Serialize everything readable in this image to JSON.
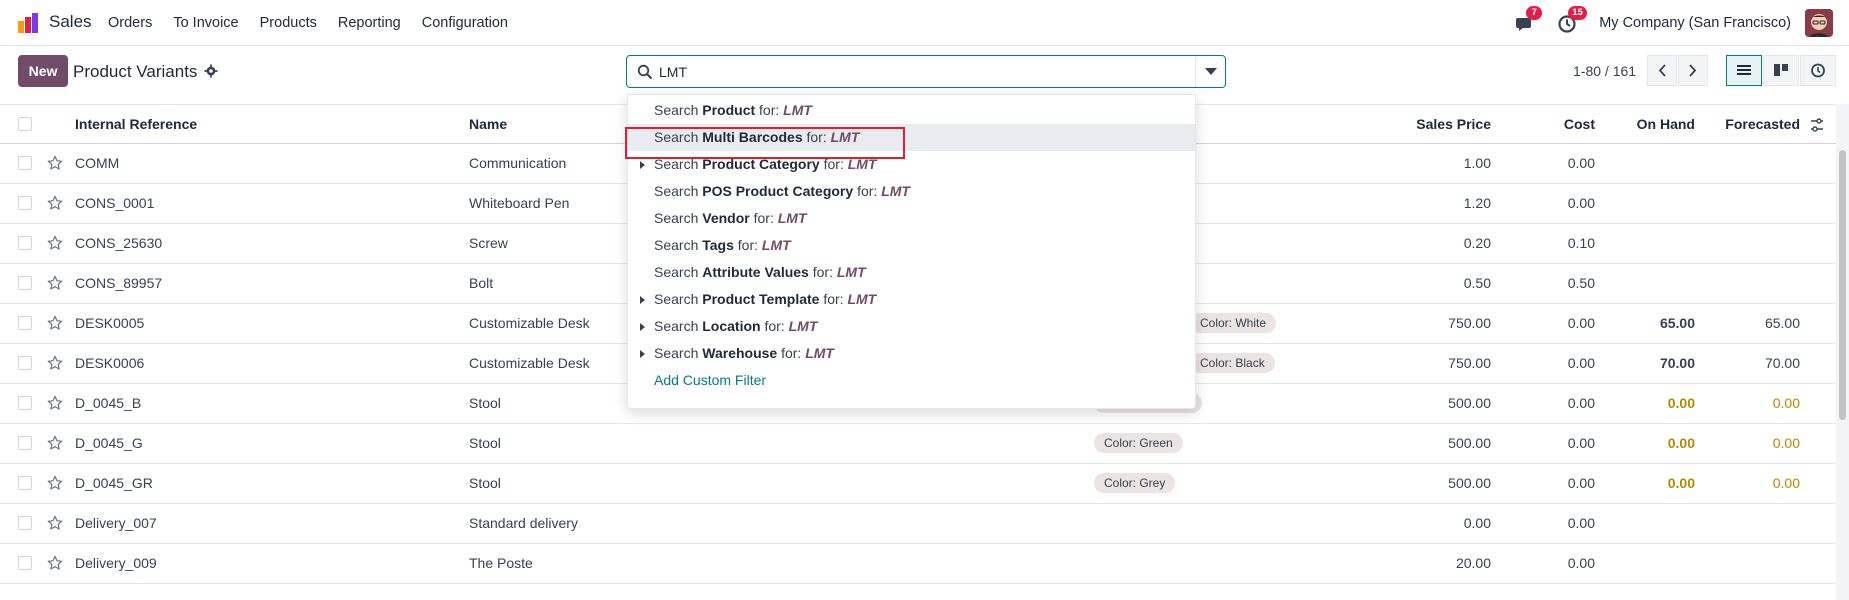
{
  "navbar": {
    "app_name": "Sales",
    "menu": [
      "Orders",
      "To Invoice",
      "Products",
      "Reporting",
      "Configuration"
    ],
    "messages_badge": "7",
    "activities_badge": "15",
    "company": "My Company (San Francisco)"
  },
  "control": {
    "new_label": "New",
    "title": "Product Variants",
    "search_value": "LMT",
    "pager": "1-80 / 161"
  },
  "columns": {
    "internal_reference": "Internal Reference",
    "name": "Name",
    "sales_price": "Sales Price",
    "cost": "Cost",
    "on_hand": "On Hand",
    "forecasted": "Forecasted"
  },
  "rows": [
    {
      "ref": "COMM",
      "name": "Communication",
      "tag": "",
      "price": "1.00",
      "cost": "0.00",
      "onhand": "",
      "forecast": ""
    },
    {
      "ref": "CONS_0001",
      "name": "Whiteboard Pen",
      "tag": "",
      "price": "1.20",
      "cost": "0.00",
      "onhand": "",
      "forecast": ""
    },
    {
      "ref": "CONS_25630",
      "name": "Screw",
      "tag": "",
      "price": "0.20",
      "cost": "0.10",
      "onhand": "",
      "forecast": ""
    },
    {
      "ref": "CONS_89957",
      "name": "Bolt",
      "tag": "",
      "price": "0.50",
      "cost": "0.50",
      "onhand": "",
      "forecast": ""
    },
    {
      "ref": "DESK0005",
      "name": "Customizable Desk",
      "tag": "Color: White",
      "price": "750.00",
      "cost": "0.00",
      "onhand": "65.00",
      "forecast": "65.00"
    },
    {
      "ref": "DESK0006",
      "name": "Customizable Desk",
      "tag": "Color: Black",
      "price": "750.00",
      "cost": "0.00",
      "onhand": "70.00",
      "forecast": "70.00"
    },
    {
      "ref": "D_0045_B",
      "name": "Stool",
      "tag": "",
      "price": "500.00",
      "cost": "0.00",
      "onhand": "0.00",
      "forecast": "0.00"
    },
    {
      "ref": "D_0045_G",
      "name": "Stool",
      "tag": "Color: Green",
      "price": "500.00",
      "cost": "0.00",
      "onhand": "0.00",
      "forecast": "0.00"
    },
    {
      "ref": "D_0045_GR",
      "name": "Stool",
      "tag": "Color: Grey",
      "price": "500.00",
      "cost": "0.00",
      "onhand": "0.00",
      "forecast": "0.00"
    },
    {
      "ref": "Delivery_007",
      "name": "Standard delivery",
      "tag": "",
      "price": "0.00",
      "cost": "0.00",
      "onhand": "",
      "forecast": ""
    },
    {
      "ref": "Delivery_009",
      "name": "The Poste",
      "tag": "",
      "price": "20.00",
      "cost": "0.00",
      "onhand": "",
      "forecast": ""
    }
  ],
  "dropdown": {
    "prefix": "Search",
    "for": "for:",
    "query": "LMT",
    "items": [
      {
        "field": "Product",
        "expandable": false
      },
      {
        "field": "Multi Barcodes",
        "expandable": false
      },
      {
        "field": "Product Category",
        "expandable": true
      },
      {
        "field": "POS Product Category",
        "expandable": false
      },
      {
        "field": "Vendor",
        "expandable": false
      },
      {
        "field": "Tags",
        "expandable": false
      },
      {
        "field": "Attribute Values",
        "expandable": false
      },
      {
        "field": "Product Template",
        "expandable": true
      },
      {
        "field": "Location",
        "expandable": true
      },
      {
        "field": "Warehouse",
        "expandable": true
      }
    ],
    "custom_filter": "Add Custom Filter"
  },
  "colors": {
    "brand": "#714b67",
    "accent": "#017e84",
    "warning": "#b58900",
    "badge": "#e11d48"
  }
}
